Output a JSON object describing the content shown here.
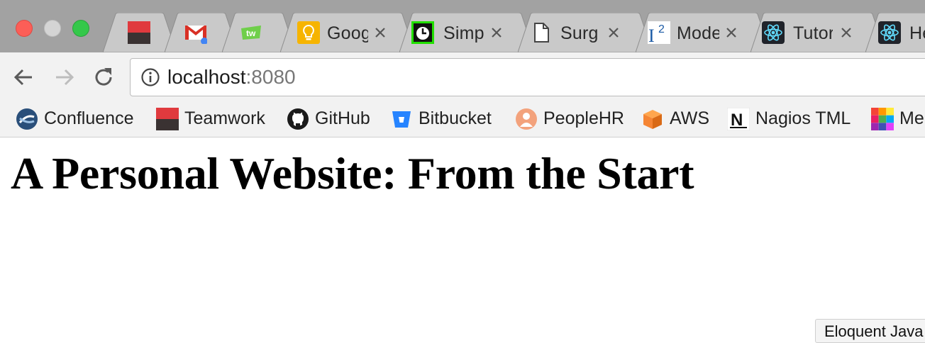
{
  "tabs": [
    {
      "title": "",
      "icon": "teamwork-icon"
    },
    {
      "title": "",
      "icon": "gmail-icon"
    },
    {
      "title": "",
      "icon": "tw-icon"
    },
    {
      "title": "Goog",
      "icon": "lightbulb-icon"
    },
    {
      "title": "Simp",
      "icon": "clock-icon"
    },
    {
      "title": "Surg",
      "icon": "document-icon"
    },
    {
      "title": "Mode",
      "icon": "i-squared-icon"
    },
    {
      "title": "Tutor",
      "icon": "react-icon"
    },
    {
      "title": "He",
      "icon": "react-icon"
    }
  ],
  "address_bar": {
    "host": "localhost",
    "port": ":8080"
  },
  "bookmarks": [
    {
      "label": "Confluence",
      "icon": "confluence-icon"
    },
    {
      "label": "Teamwork",
      "icon": "teamwork-icon"
    },
    {
      "label": "GitHub",
      "icon": "github-icon"
    },
    {
      "label": "Bitbucket",
      "icon": "bitbucket-icon"
    },
    {
      "label": "PeopleHR",
      "icon": "peoplehr-icon"
    },
    {
      "label": "AWS",
      "icon": "aws-icon"
    },
    {
      "label": "Nagios TML",
      "icon": "nagios-icon"
    },
    {
      "label": "Me",
      "icon": "grid-icon"
    }
  ],
  "page": {
    "heading": "A Personal Website: From the Start"
  },
  "status_bubble": {
    "text": "Eloquent Java"
  },
  "colors": {
    "tabstrip_bg": "#a2a2a2",
    "active_tab_bg": "#f2f2f2",
    "inactive_tab_bg": "#c9c9c9",
    "teamwork_red": "#e03a3e",
    "react_blue": "#61dafb"
  }
}
